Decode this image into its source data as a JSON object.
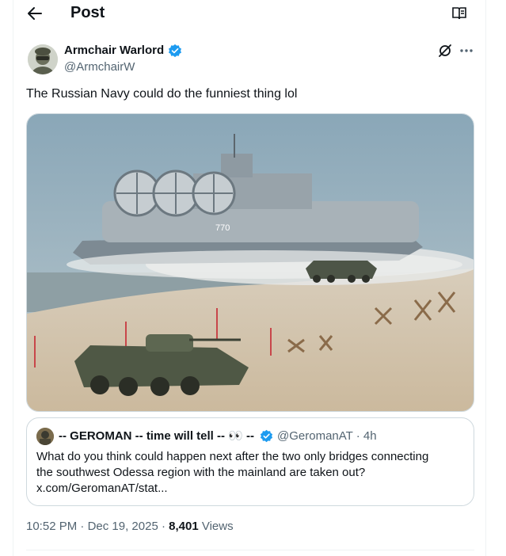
{
  "header": {
    "title": "Post"
  },
  "post": {
    "author_name": "Armchair Warlord",
    "handle": "@ArmchairW",
    "text": "The Russian Navy could do the funniest thing lol",
    "image_hull_number": "770"
  },
  "quoted": {
    "name": "-- GEROMAN -- time will tell -- 👀 --",
    "handle": "@GeromanAT",
    "separator": "·",
    "time": "4h",
    "text_line1": "What do you think could happen next after the two only bridges connecting",
    "text_line2": "the southwest Odessa region with the mainland are taken out?",
    "link": "x.com/GeromanAT/stat..."
  },
  "meta": {
    "time": "10:52 PM",
    "dot": "·",
    "date": "Dec 19, 2025",
    "views_count": "8,401",
    "views_label": "Views"
  },
  "colors": {
    "verified": "#1d9bf0",
    "secondary_text": "#536471",
    "border": "#cfd9de"
  },
  "icons": [
    "back-arrow-icon",
    "reader-mode-icon",
    "verified-badge-icon",
    "grok-icon",
    "more-icon"
  ]
}
